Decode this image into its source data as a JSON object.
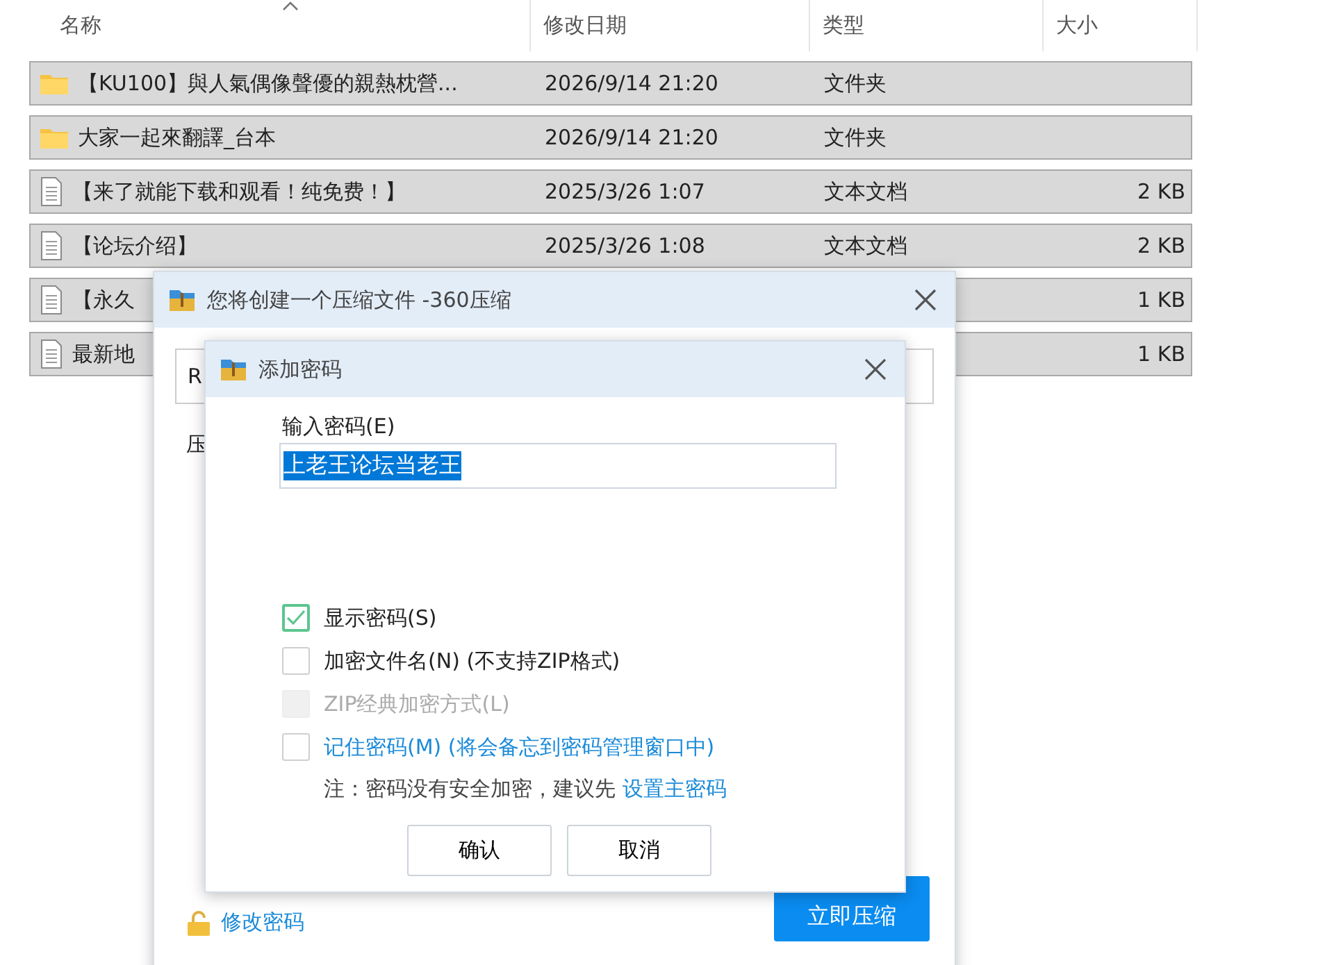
{
  "file_list": {
    "columns": [
      "名称",
      "修改日期",
      "类型",
      "大小"
    ],
    "rows": [
      {
        "kind": "folder",
        "name": "【KU100】與人氣偶像聲優的親熱枕營...",
        "modified": "2026/9/14 21:20",
        "type": "文件夹"
      },
      {
        "kind": "folder",
        "name": "大家一起來翻譯_台本",
        "modified": "2026/9/14 21:20",
        "type": "文件夹"
      },
      {
        "kind": "text",
        "name": "【来了就能下载和观看！纯免费！】",
        "modified": "2025/3/26 1:07",
        "type": "文本文档",
        "size": "2 KB"
      },
      {
        "kind": "text",
        "name": "【论坛介绍】",
        "modified": "2025/3/26 1:08",
        "type": "文本文档",
        "size": "2 KB"
      },
      {
        "kind": "text",
        "name": "【永久",
        "size": "1 KB"
      },
      {
        "kind": "text",
        "name": "最新地",
        "size": "1 KB"
      }
    ]
  },
  "compress_dialog": {
    "title": "您将创建一个压缩文件 -360压缩",
    "path_field": {
      "value": "R"
    },
    "label": "压",
    "change_password_link": "修改密码",
    "compress_button": "立即压缩"
  },
  "password_dialog": {
    "title": "添加密码",
    "password_label": "输入密码(E)",
    "password_field": {
      "value": "上老王论坛当老王",
      "selected": true
    },
    "options": [
      {
        "kind": "plain",
        "label": "显示密码(S)",
        "checked": true,
        "disabled": false
      },
      {
        "kind": "plain",
        "label": "加密文件名(N) (不支持ZIP格式)",
        "checked": false,
        "disabled": false
      },
      {
        "kind": "plain",
        "label": "ZIP经典加密方式(L)",
        "checked": false,
        "disabled": true
      },
      {
        "kind": "link",
        "label": "记住密码(M) (将会备忘到密码管理窗口中)",
        "checked": false,
        "disabled": false
      }
    ],
    "note": {
      "text": "注：密码没有安全加密，建议先",
      "link": "设置主密码"
    },
    "buttons": [
      "确认",
      "取消"
    ]
  }
}
